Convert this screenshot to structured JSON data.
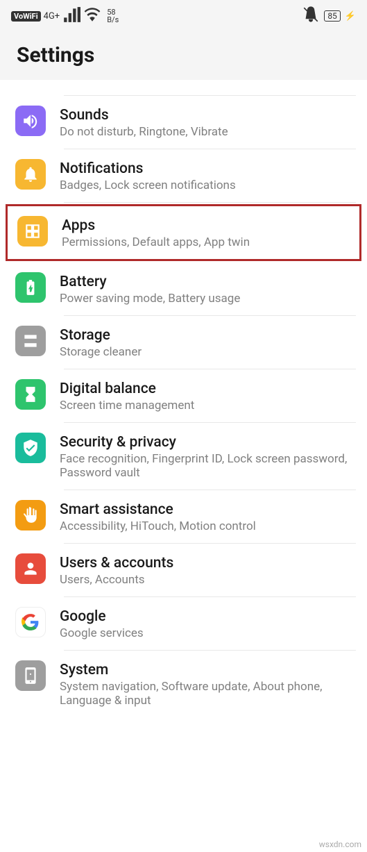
{
  "status": {
    "vowifi": "VoWiFi",
    "net": "4G+",
    "speed_num": "58",
    "speed_unit": "B/s",
    "battery": "85"
  },
  "header": {
    "title": "Settings"
  },
  "items": [
    {
      "title": "Sounds",
      "sub": "Do not disturb, Ringtone, Vibrate"
    },
    {
      "title": "Notifications",
      "sub": "Badges, Lock screen notifications"
    },
    {
      "title": "Apps",
      "sub": "Permissions, Default apps, App twin"
    },
    {
      "title": "Battery",
      "sub": "Power saving mode, Battery usage"
    },
    {
      "title": "Storage",
      "sub": "Storage cleaner"
    },
    {
      "title": "Digital balance",
      "sub": "Screen time management"
    },
    {
      "title": "Security & privacy",
      "sub": "Face recognition, Fingerprint ID, Lock screen password, Password vault"
    },
    {
      "title": "Smart assistance",
      "sub": "Accessibility, HiTouch, Motion control"
    },
    {
      "title": "Users & accounts",
      "sub": "Users, Accounts"
    },
    {
      "title": "Google",
      "sub": "Google services"
    },
    {
      "title": "System",
      "sub": "System navigation, Software update, About phone, Language & input"
    }
  ],
  "watermark": "wsxdn.com"
}
